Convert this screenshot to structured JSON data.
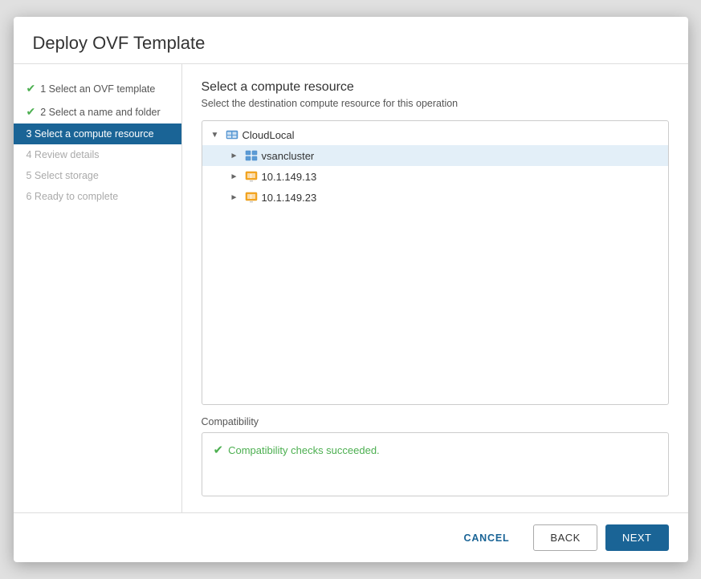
{
  "dialog": {
    "title": "Deploy OVF Template"
  },
  "sidebar": {
    "items": [
      {
        "id": "step1",
        "label": "1 Select an OVF template",
        "state": "completed"
      },
      {
        "id": "step2",
        "label": "2 Select a name and folder",
        "state": "completed"
      },
      {
        "id": "step3",
        "label": "3 Select a compute resource",
        "state": "active"
      },
      {
        "id": "step4",
        "label": "4 Review details",
        "state": "disabled"
      },
      {
        "id": "step5",
        "label": "5 Select storage",
        "state": "disabled"
      },
      {
        "id": "step6",
        "label": "6 Ready to complete",
        "state": "disabled"
      }
    ]
  },
  "main": {
    "title": "Select a compute resource",
    "subtitle": "Select the destination compute resource for this operation",
    "tree": {
      "root": {
        "label": "CloudLocal",
        "expanded": true,
        "children": [
          {
            "label": "vsancluster",
            "type": "cluster",
            "selected": true,
            "expanded": false,
            "children": []
          },
          {
            "label": "10.1.149.13",
            "type": "host",
            "selected": false,
            "expanded": false,
            "children": []
          },
          {
            "label": "10.1.149.23",
            "type": "host",
            "selected": false,
            "expanded": false,
            "children": []
          }
        ]
      }
    },
    "compatibility": {
      "label": "Compatibility",
      "status": "success",
      "message": "Compatibility checks succeeded."
    }
  },
  "footer": {
    "cancel_label": "CANCEL",
    "back_label": "BACK",
    "next_label": "NEXT"
  }
}
